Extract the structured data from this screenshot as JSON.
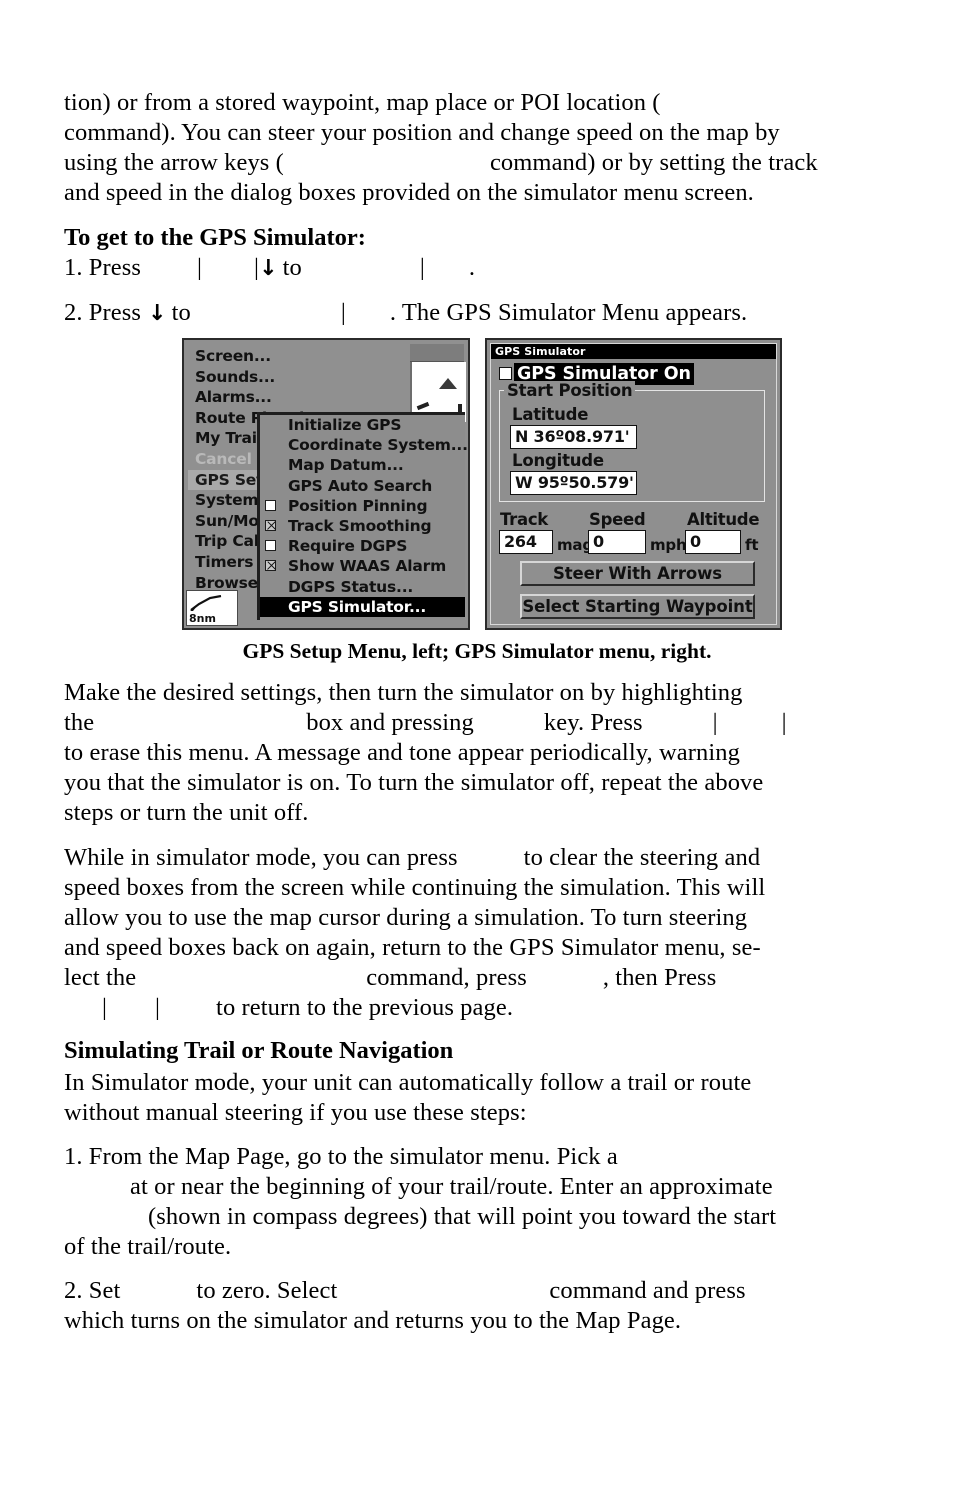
{
  "document": {
    "paragraphs": {
      "p1": {
        "line1_a": "tion) or from a stored waypoint, map place or POI location (",
        "line2_a": "command). You can steer your position and change speed on the map by",
        "line3_a": "using the arrow keys (",
        "line3_b": "command) or by setting the track",
        "line4_a": "and speed in the dialog boxes provided on the simulator menu screen."
      },
      "heading1": "To get to the GPS Simulator:",
      "step1": {
        "a": "1. Press",
        "bar1": "|",
        "bar2": "|",
        "arrow": "↓",
        "b": "to",
        "bar3": "|",
        "c": "."
      },
      "step2": {
        "a": "2. Press",
        "arrow": "↓",
        "b": "to",
        "bar1": "|",
        "c": ". The GPS Simulator Menu appears."
      },
      "caption": "GPS Setup Menu, left; GPS Simulator menu, right.",
      "p2": {
        "line1": "Make the desired settings, then turn the simulator on by highlighting",
        "line2_a": "the",
        "line2_b": "box and pressing",
        "line2_c": "key. Press",
        "line2_bar1": "|",
        "line2_bar2": "|",
        "line3": "to erase this menu. A message and tone appear periodically, warning",
        "line4": "you that the simulator is on. To turn the simulator off, repeat the above",
        "line5": "steps or turn the unit off."
      },
      "p3": {
        "line1_a": "While in simulator mode, you can press",
        "line1_b": "to clear the steering and",
        "line2": "speed boxes from the screen while continuing the simulation. This will",
        "line3": "allow you to use the map cursor during a simulation. To turn steering",
        "line4": "and speed boxes back on again, return to the GPS Simulator menu, se-",
        "line5_a": "lect  the",
        "line5_b": "command,   press",
        "line5_c": ",    then    Press",
        "line6_bar1": "|",
        "line6_bar2": "|",
        "line6_a": "to return to the previous page."
      },
      "heading2": "Simulating Trail or Route Navigation",
      "p4": {
        "line1": "In Simulator mode, your unit can automatically follow a trail or route",
        "line2": "without manual steering if you use these steps:"
      },
      "p5": {
        "line1_a": "1. From the Map Page, go to the simulator menu. Pick a",
        "line2_a": "at or near the beginning of your trail/route. Enter an approximate",
        "line3_a": "(shown in compass degrees) that will point you toward the start",
        "line4_a": "of the trail/route."
      },
      "p6": {
        "line1_a": "2. Set",
        "line1_b": "to zero. Select",
        "line1_c": "command and press",
        "line2_a": "which turns on the simulator and returns you to the Map Page."
      }
    }
  },
  "gps_setup_screen": {
    "title": "GPS Setup Menu",
    "menu_items": [
      {
        "label": "Screen...",
        "state": "normal"
      },
      {
        "label": "Sounds...",
        "state": "normal"
      },
      {
        "label": "Alarms...",
        "state": "normal"
      },
      {
        "label": "Route Planning",
        "state": "normal"
      },
      {
        "label": "My Trails",
        "state": "normal"
      },
      {
        "label": "Cancel Navigation",
        "state": "disabled"
      },
      {
        "label": "GPS Setup",
        "state": "selected"
      },
      {
        "label": "System Setup",
        "state": "normal"
      },
      {
        "label": "Sun/Moon Calculations",
        "state": "normal"
      },
      {
        "label": "Trip Calculator",
        "state": "normal"
      },
      {
        "label": "Timers",
        "state": "normal"
      },
      {
        "label": "Browse",
        "state": "normal"
      }
    ],
    "scale_label": "8nm",
    "submenu": {
      "items": [
        {
          "label": "Initialize GPS",
          "type": "item",
          "highlighted": false
        },
        {
          "label": "Coordinate System...",
          "type": "item",
          "highlighted": false
        },
        {
          "label": "Map Datum...",
          "type": "item",
          "highlighted": false
        },
        {
          "label": "GPS Auto Search",
          "type": "item",
          "highlighted": false
        },
        {
          "label": "Position Pinning",
          "type": "checkbox",
          "checked": false,
          "highlighted": false
        },
        {
          "label": "Track Smoothing",
          "type": "checkbox",
          "checked": true,
          "highlighted": false
        },
        {
          "label": "Require DGPS",
          "type": "checkbox",
          "checked": false,
          "highlighted": false
        },
        {
          "label": "Show WAAS Alarm",
          "type": "checkbox",
          "checked": true,
          "highlighted": false
        },
        {
          "label": "DGPS Status...",
          "type": "item",
          "highlighted": false
        },
        {
          "label": "GPS Simulator...",
          "type": "item",
          "highlighted": true
        }
      ]
    }
  },
  "gps_simulator_screen": {
    "title": "GPS Simulator",
    "simulator_on": {
      "label": "GPS Simulator On",
      "checked": false
    },
    "start_position": {
      "legend": "Start Position",
      "latitude_label": "Latitude",
      "latitude_value": "N   36º08.971'",
      "longitude_label": "Longitude",
      "longitude_value": "W   95º50.579'"
    },
    "track": {
      "label": "Track",
      "value": "264",
      "unit": "mag"
    },
    "speed": {
      "label": "Speed",
      "value": "0",
      "unit": "mph"
    },
    "altitude": {
      "label": "Altitude",
      "value": "0",
      "unit": "ft"
    },
    "buttons": {
      "steer": "Steer With Arrows",
      "waypoint": "Select Starting Waypoint"
    }
  }
}
